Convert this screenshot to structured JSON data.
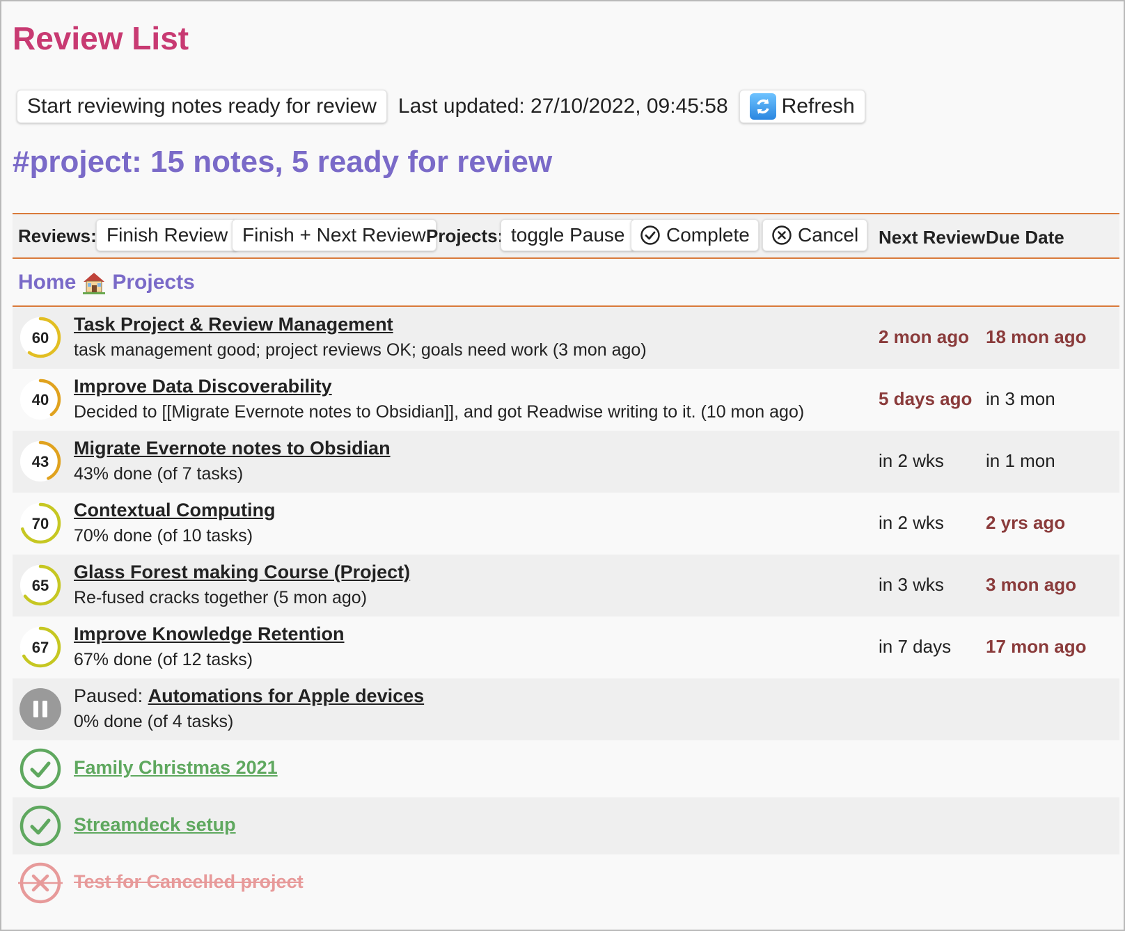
{
  "page": {
    "title": "Review List",
    "start_button": "Start reviewing notes ready for review",
    "last_updated": "Last updated: 27/10/2022, 09:45:58",
    "refresh_label": "Refresh",
    "section_heading": "#project: 15 notes, 5 ready for review"
  },
  "header": {
    "reviews_label": "Reviews:",
    "finish_review": "Finish Review",
    "finish_next_review": "Finish + Next Review",
    "projects_label": "Projects:",
    "toggle_pause": "toggle Pause",
    "complete": "Complete",
    "cancel": "Cancel",
    "col_next_review": "Next Review",
    "col_due_date": "Due Date"
  },
  "folder": {
    "home": "Home",
    "name": "Projects"
  },
  "rows": [
    {
      "progress": 60,
      "title": "Task Project & Review Management",
      "subtitle": "task management good; project reviews OK; goals need work (3 mon ago)",
      "next_review": "2 mon ago",
      "due_date": "18 mon ago"
    },
    {
      "progress": 40,
      "title": "Improve Data Discoverability",
      "subtitle": "Decided to [[Migrate Evernote notes to Obsidian]], and got Readwise writing to it. (10 mon ago)",
      "next_review": "5 days ago",
      "due_date": "in 3 mon"
    },
    {
      "progress": 43,
      "title": "Migrate Evernote notes to Obsidian",
      "subtitle": "43% done (of 7 tasks)",
      "next_review": "in 2 wks",
      "due_date": "in 1 mon"
    },
    {
      "progress": 70,
      "title": "Contextual Computing",
      "subtitle": "70% done (of 10 tasks)",
      "next_review": "in 2 wks",
      "due_date": "2 yrs ago"
    },
    {
      "progress": 65,
      "title": "Glass Forest making Course (Project)",
      "subtitle": "Re-fused cracks together (5 mon ago)",
      "next_review": "in 3 wks",
      "due_date": "3 mon ago"
    },
    {
      "progress": 67,
      "title": "Improve Knowledge Retention",
      "subtitle": "67% done (of 12 tasks)",
      "next_review": "in 7 days",
      "due_date": "17 mon ago"
    }
  ],
  "paused_row": {
    "paused_label": "Paused: ",
    "title": "Automations for Apple devices",
    "subtitle": "0% done (of 4 tasks)"
  },
  "completed_rows": [
    {
      "title": "Family Christmas 2021"
    },
    {
      "title": "Streamdeck setup"
    }
  ],
  "cancelled_row": {
    "title": "Test for Cancelled project"
  },
  "colors": {
    "title": "#c83a72",
    "heading": "#7a6ac8",
    "accent_rule": "#d97a3a",
    "overdue": "#8a3b3b",
    "complete": "#5fa85f",
    "cancelled": "#e79a9a",
    "paused": "#9a9a9a"
  }
}
